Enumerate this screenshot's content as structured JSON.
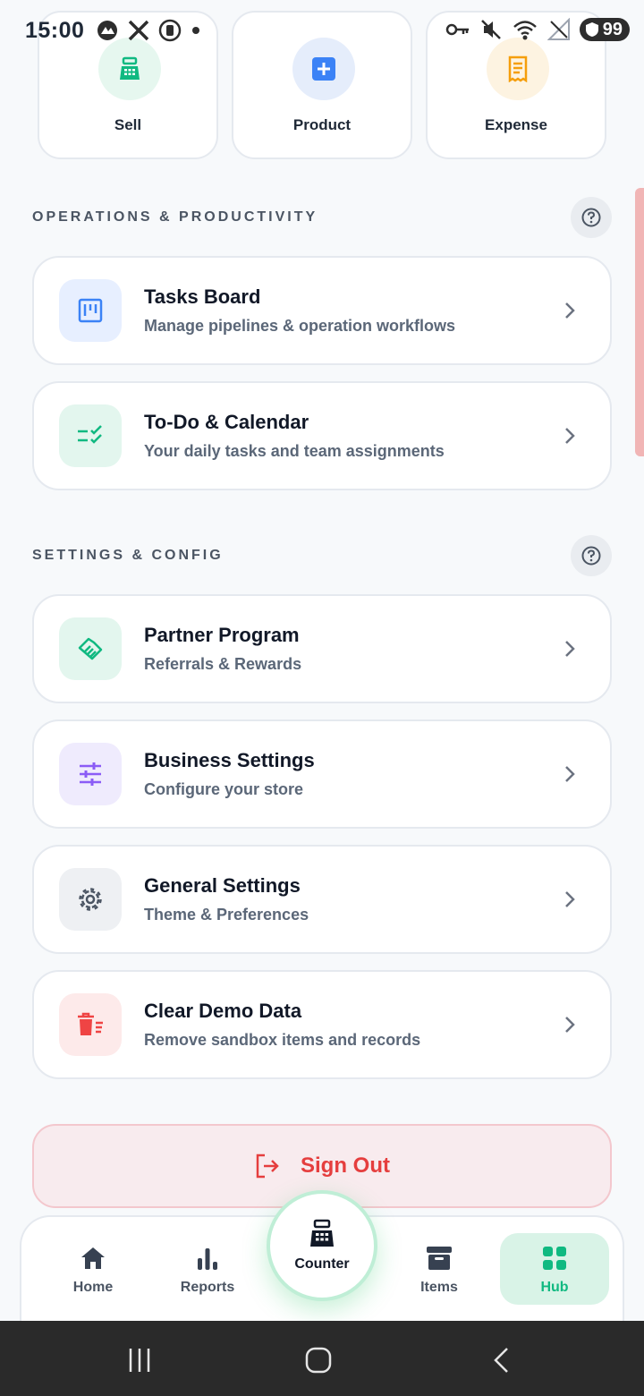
{
  "status_bar": {
    "time": "15:00",
    "battery": "99",
    "left_icons": [
      "cloud-icon",
      "x-logo-icon",
      "recording-icon",
      "dot-icon"
    ],
    "right_icons": [
      "vpn-key-icon",
      "mute-icon",
      "wifi-icon",
      "signal-icon",
      "battery-icon"
    ]
  },
  "quick_actions": [
    {
      "label": "Sell",
      "icon": "cash-register-icon",
      "color": "#10b981",
      "bg": "#e6f7ef"
    },
    {
      "label": "Product",
      "icon": "plus-square-icon",
      "color": "#3b82f6",
      "bg": "#e5edfb"
    },
    {
      "label": "Expense",
      "icon": "receipt-icon",
      "color": "#f59e0b",
      "bg": "#fdf3e1"
    }
  ],
  "sections": {
    "operations": {
      "title": "OPERATIONS & PRODUCTIVITY",
      "items": [
        {
          "title": "Tasks Board",
          "subtitle": "Manage pipelines & operation workflows",
          "icon": "kanban-icon",
          "color": "#3b82f6",
          "bg": "#e7efff"
        },
        {
          "title": "To-Do & Calendar",
          "subtitle": "Your daily tasks and team assignments",
          "icon": "checklist-icon",
          "color": "#10b981",
          "bg": "#e3f6ee"
        }
      ]
    },
    "settings": {
      "title": "SETTINGS & CONFIG",
      "items": [
        {
          "title": "Partner Program",
          "subtitle": "Referrals & Rewards",
          "icon": "handshake-icon",
          "color": "#10b981",
          "bg": "#e3f6ee"
        },
        {
          "title": "Business Settings",
          "subtitle": "Configure your store",
          "icon": "sliders-icon",
          "color": "#8b5cf6",
          "bg": "#efebfd"
        },
        {
          "title": "General Settings",
          "subtitle": "Theme & Preferences",
          "icon": "gear-icon",
          "color": "#4b5563",
          "bg": "#eef0f3"
        },
        {
          "title": "Clear Demo Data",
          "subtitle": "Remove sandbox items and records",
          "icon": "trash-icon",
          "color": "#ef4444",
          "bg": "#fdeaea"
        }
      ]
    }
  },
  "sign_out": {
    "label": "Sign Out",
    "color": "#e53e3e"
  },
  "bottom_nav": {
    "items": [
      {
        "label": "Home",
        "icon": "home-icon"
      },
      {
        "label": "Reports",
        "icon": "bar-chart-icon"
      },
      {
        "label": "Counter",
        "icon": "cash-register-icon"
      },
      {
        "label": "Items",
        "icon": "archive-box-icon"
      },
      {
        "label": "Hub",
        "icon": "grid-icon"
      }
    ],
    "active": "Hub",
    "active_color": "#10b981"
  }
}
